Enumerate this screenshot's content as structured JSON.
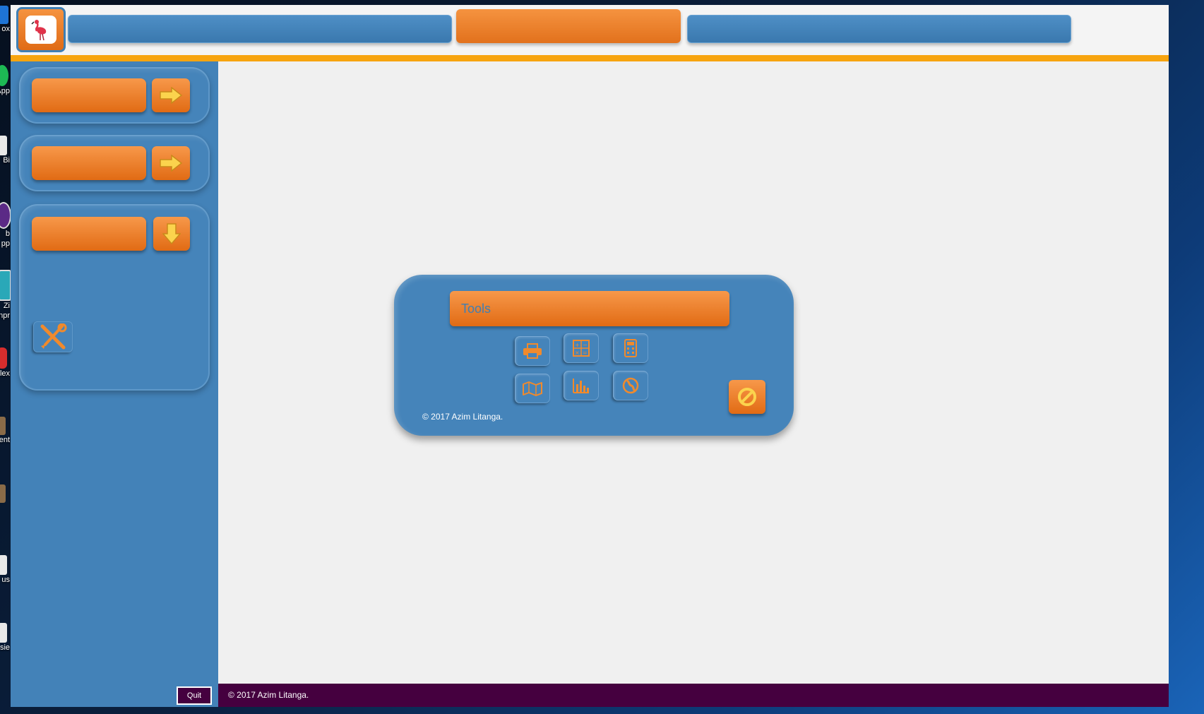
{
  "desktop": {
    "items": [
      {
        "label": "ox",
        "icon": "app-shortcut-icon"
      },
      {
        "label": "App",
        "icon": "whatsapp-icon"
      },
      {
        "label": "Bi",
        "icon": "recycle-bin-icon"
      },
      {
        "label": "b\npp",
        "icon": "web-app-icon"
      },
      {
        "label": "Zi\nnpr",
        "icon": "zip-compressor-icon"
      },
      {
        "label": "lex",
        "icon": "flexi-app-icon"
      },
      {
        "label": "ent.",
        "icon": "document-icon"
      },
      {
        "label": "",
        "icon": "file-icon"
      },
      {
        "label": "us",
        "icon": "file-icon"
      },
      {
        "label": "ssie",
        "icon": "file-icon"
      }
    ]
  },
  "header": {
    "logo_icon": "flamingo-icon",
    "tabs": [
      {
        "label": "",
        "state": "inactive"
      },
      {
        "label": "",
        "state": "active"
      },
      {
        "label": "",
        "state": "inactive"
      }
    ]
  },
  "sidebar": {
    "groups": [
      {
        "button_label": "",
        "arrow": "arrow-right-icon"
      },
      {
        "button_label": "",
        "arrow": "arrow-right-icon"
      },
      {
        "button_label": "",
        "arrow": "arrow-down-icon",
        "tools_icon": "tools-icon"
      }
    ],
    "quit_label": "Quit"
  },
  "tools_panel": {
    "title": "Tools",
    "buttons": [
      {
        "icon": "printer-icon"
      },
      {
        "icon": "math-symbols-icon"
      },
      {
        "icon": "calculator-icon"
      },
      {
        "icon": "map-icon"
      },
      {
        "icon": "bar-chart-icon"
      },
      {
        "icon": "globe-icon"
      }
    ],
    "cancel_icon": "cancel-icon",
    "copyright": "© 2017 Azim Litanga."
  },
  "footer": {
    "copyright": "© 2017 Azim Litanga."
  },
  "colors": {
    "window_bg": "#f0f0f0",
    "sidebar_blue": "#4382b8",
    "accent_orange": "#e97a23",
    "accent_line": "#f7a40f",
    "footer_purple": "#45003f",
    "tools_title_text": "#3f7fb4"
  }
}
